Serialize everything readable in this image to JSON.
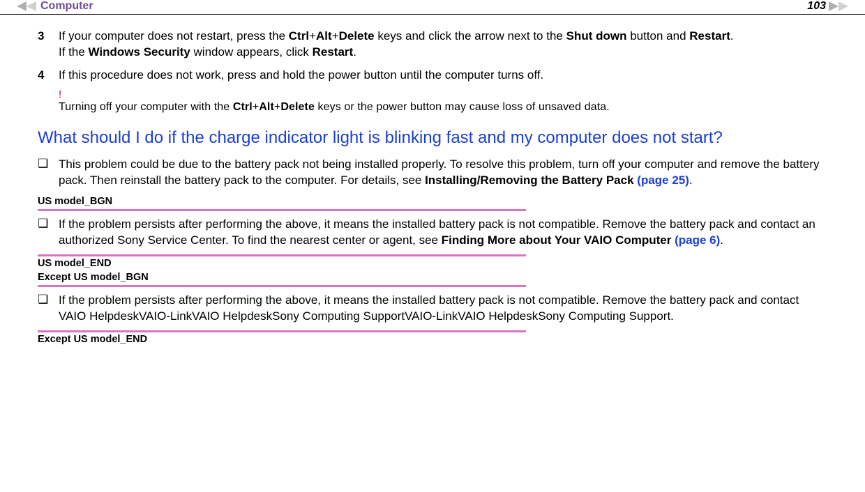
{
  "header": {
    "title": "Computer",
    "page_number": "103"
  },
  "steps": [
    {
      "num": "3",
      "parts": [
        {
          "t": "If your computer does not restart, press the "
        },
        {
          "t": "Ctrl",
          "b": true
        },
        {
          "t": "+"
        },
        {
          "t": "Alt",
          "b": true
        },
        {
          "t": "+"
        },
        {
          "t": "Delete",
          "b": true
        },
        {
          "t": " keys and click the arrow next to the "
        },
        {
          "t": "Shut down",
          "b": true
        },
        {
          "t": " button and "
        },
        {
          "t": "Restart",
          "b": true
        },
        {
          "t": "."
        }
      ],
      "extra": [
        {
          "t": "If the "
        },
        {
          "t": "Windows Security",
          "b": true
        },
        {
          "t": " window appears, click "
        },
        {
          "t": "Restart",
          "b": true
        },
        {
          "t": "."
        }
      ]
    },
    {
      "num": "4",
      "parts": [
        {
          "t": "If this procedure does not work, press and hold the power button until the computer turns off."
        }
      ]
    }
  ],
  "warning": {
    "bang": "!",
    "parts": [
      {
        "t": "Turning off your computer with the "
      },
      {
        "t": "Ctrl",
        "b": true
      },
      {
        "t": "+"
      },
      {
        "t": "Alt",
        "b": true
      },
      {
        "t": "+"
      },
      {
        "t": "Delete",
        "b": true
      },
      {
        "t": " keys or the power button may cause loss of unsaved data."
      }
    ]
  },
  "heading": "What should I do if the charge indicator light is blinking fast and my computer does not start?",
  "bullets_before": [
    {
      "parts": [
        {
          "t": "This problem could be due to the battery pack not being installed properly. To resolve this problem, turn off your computer and remove the battery pack. Then reinstall the battery pack to the computer. For details, see "
        },
        {
          "t": "Installing/Removing the Battery Pack ",
          "b": true
        },
        {
          "t": "(page 25)",
          "link": true
        },
        {
          "t": "."
        }
      ]
    }
  ],
  "regions": {
    "us_bgn": "US model_BGN",
    "us_end": "US model_END",
    "except_bgn": "Except US model_BGN",
    "except_end": "Except US model_END"
  },
  "us_bullets": [
    {
      "parts": [
        {
          "t": "If the problem persists after performing the above, it means the installed battery pack is not compatible. Remove the battery pack and contact an authorized Sony Service Center. To find the nearest center or agent, see "
        },
        {
          "t": "Finding More about Your VAIO Computer ",
          "b": true
        },
        {
          "t": "(page 6)",
          "link": true
        },
        {
          "t": "."
        }
      ]
    }
  ],
  "except_bullets": [
    {
      "parts": [
        {
          "t": "If the problem persists after performing the above, it means the installed battery pack is not compatible. Remove the battery pack and contact VAIO HelpdeskVAIO-LinkVAIO HelpdeskSony Computing SupportVAIO-LinkVAIO HelpdeskSony Computing Support."
        }
      ]
    }
  ]
}
